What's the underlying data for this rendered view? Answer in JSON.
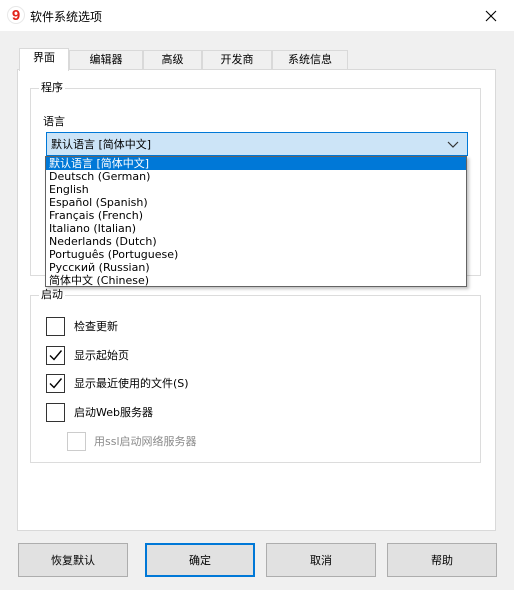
{
  "window": {
    "title": "软件系统选项",
    "app_icon_glyph": "9",
    "accent": "#0078d7"
  },
  "tabs": [
    {
      "label": "界面",
      "active": true
    },
    {
      "label": "编辑器",
      "active": false
    },
    {
      "label": "高级",
      "active": false
    },
    {
      "label": "开发商",
      "active": false
    },
    {
      "label": "系统信息",
      "active": false
    }
  ],
  "program_group": {
    "title": "程序",
    "language_label": "语言",
    "language_value": "默认语言 [简体中文]",
    "language_options": [
      "默认语言 [简体中文]",
      "Deutsch (German)",
      "English",
      "Español (Spanish)",
      "Français (French)",
      "Italiano (Italian)",
      "Nederlands (Dutch)",
      "Português (Portuguese)",
      "Русский (Russian)",
      "简体中文 (Chinese)"
    ]
  },
  "startup_group": {
    "title": "启动",
    "options": [
      {
        "label": "检查更新",
        "checked": false,
        "disabled": false
      },
      {
        "label": "显示起始页",
        "checked": true,
        "disabled": false
      },
      {
        "label": "显示最近使用的文件(S)",
        "checked": true,
        "disabled": false
      },
      {
        "label": "启动Web服务器",
        "checked": false,
        "disabled": false
      },
      {
        "label": "用ssl启动网络服务器",
        "checked": false,
        "disabled": true
      }
    ]
  },
  "buttons": {
    "restore_default": "恢复默认",
    "ok": "确定",
    "cancel": "取消",
    "help": "帮助"
  }
}
